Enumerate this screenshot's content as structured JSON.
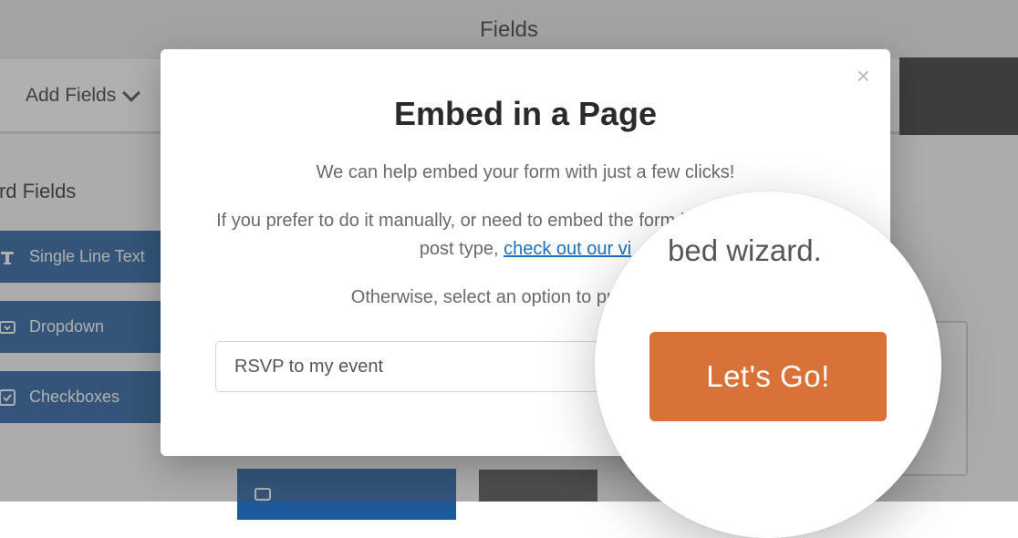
{
  "topbar": {
    "title": "Fields"
  },
  "toolbar": {
    "add_fields": "Add Fields"
  },
  "sidebar": {
    "heading": "andard Fields",
    "items": [
      {
        "label": "Single Line Text"
      },
      {
        "label": "Dropdown"
      },
      {
        "label": "Checkboxes"
      }
    ]
  },
  "modal": {
    "title": "Embed in a Page",
    "p1": "We can help embed your form with just a few clicks!",
    "p2a": "If you prefer to do it manually, or need to embed the form in a post or custom post type, ",
    "p2_link": "check out our vi",
    "p3_prefix": "Otherwise, select an option to proceed with",
    "input_value": "RSVP to my event",
    "close": "×"
  },
  "lens": {
    "text_fragment": "bed wizard.",
    "cta": "Let's Go!"
  }
}
